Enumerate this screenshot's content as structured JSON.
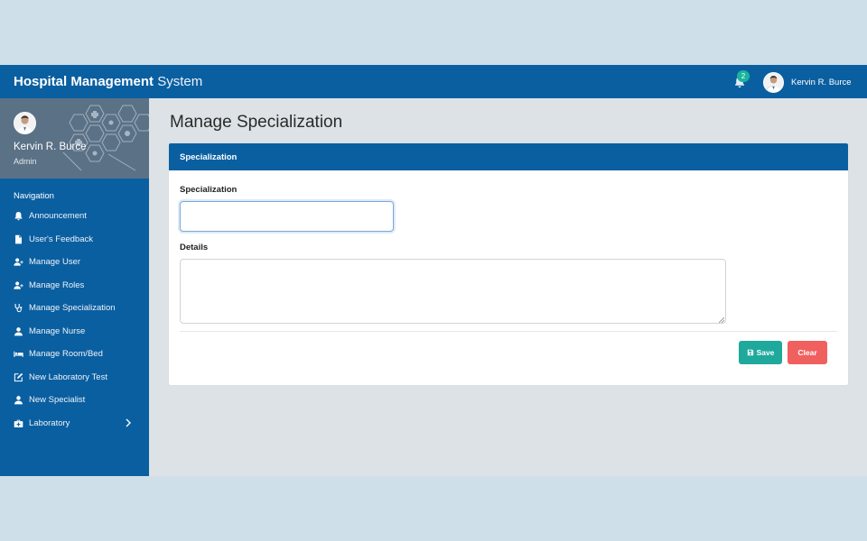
{
  "app": {
    "brand_bold": "Hospital Management",
    "brand_light": "System",
    "notification_count": "2",
    "user_name": "Kervin R. Burce"
  },
  "sidebar": {
    "profile_name": "Kervin R. Burce",
    "profile_role": "Admin",
    "nav_heading": "Navigation",
    "items": [
      {
        "label": "Announcement",
        "icon": "bell-icon"
      },
      {
        "label": "User's Feedback",
        "icon": "file-icon"
      },
      {
        "label": "Manage User",
        "icon": "user-plus-icon"
      },
      {
        "label": "Manage Roles",
        "icon": "user-plus-icon"
      },
      {
        "label": "Manage Specialization",
        "icon": "stethoscope-icon"
      },
      {
        "label": "Manage Nurse",
        "icon": "user-icon"
      },
      {
        "label": "Manage Room/Bed",
        "icon": "bed-icon"
      },
      {
        "label": "New Laboratory Test",
        "icon": "edit-icon"
      },
      {
        "label": "New Specialist",
        "icon": "user-icon"
      },
      {
        "label": "Laboratory",
        "icon": "medkit-icon",
        "has_submenu": true
      }
    ]
  },
  "main": {
    "page_title": "Manage Specialization",
    "card_title": "Specialization",
    "specialization_label": "Specialization",
    "specialization_value": "",
    "details_label": "Details",
    "details_value": "",
    "save_label": "Save",
    "clear_label": "Clear"
  },
  "colors": {
    "primary": "#0a5fa1",
    "save": "#1ea99c",
    "clear": "#f0605f",
    "badge": "#1bb39e"
  }
}
